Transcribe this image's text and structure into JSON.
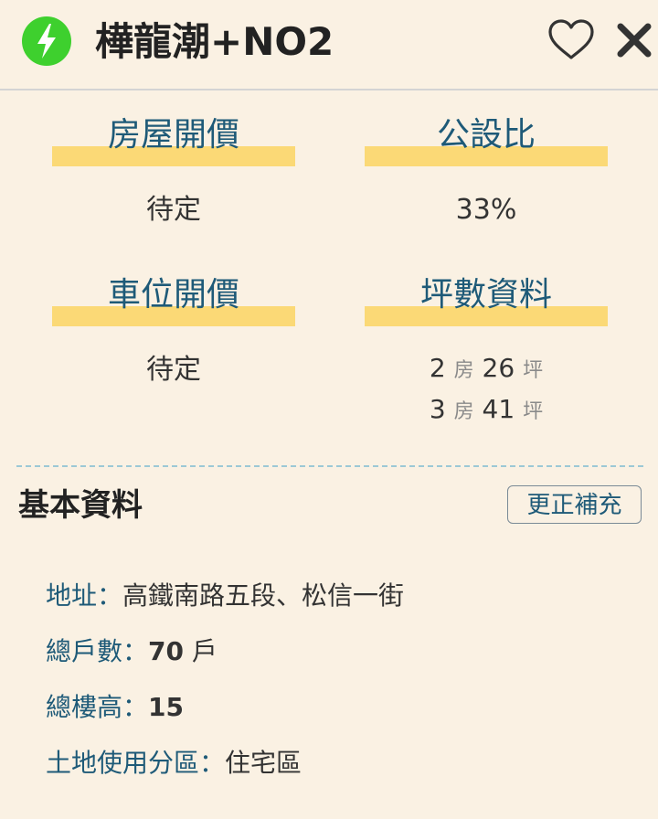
{
  "header": {
    "title": "樺龍潮+NO2",
    "bolt_icon": "lightning-bolt-icon",
    "favorite_icon": "heart-outline-icon",
    "close_icon": "close-icon"
  },
  "stats": {
    "house_price": {
      "label": "房屋開價",
      "value": "待定"
    },
    "public_ratio": {
      "label": "公設比",
      "value": "33%"
    },
    "parking_price": {
      "label": "車位開價",
      "value": "待定"
    },
    "ping_info": {
      "label": "坪數資料",
      "rows": [
        {
          "rooms": "2",
          "room_unit": "房",
          "ping": "26",
          "ping_unit": "坪"
        },
        {
          "rooms": "3",
          "room_unit": "房",
          "ping": "41",
          "ping_unit": "坪"
        }
      ]
    }
  },
  "basic_info": {
    "title": "基本資料",
    "correct_button": "更正補充",
    "address": {
      "label": "地址：",
      "value": "高鐵南路五段、松信一街"
    },
    "households": {
      "label": "總戶數：",
      "value": "70",
      "unit": " 戶"
    },
    "floors": {
      "label": "總樓高：",
      "value": "15"
    },
    "zoning": {
      "label": "土地使用分區：",
      "value": "住宅區"
    }
  },
  "colors": {
    "background": "#faf1e3",
    "accent_blue": "#1e5a78",
    "highlight_yellow": "#fbd976",
    "bolt_green": "#3ed02e"
  }
}
